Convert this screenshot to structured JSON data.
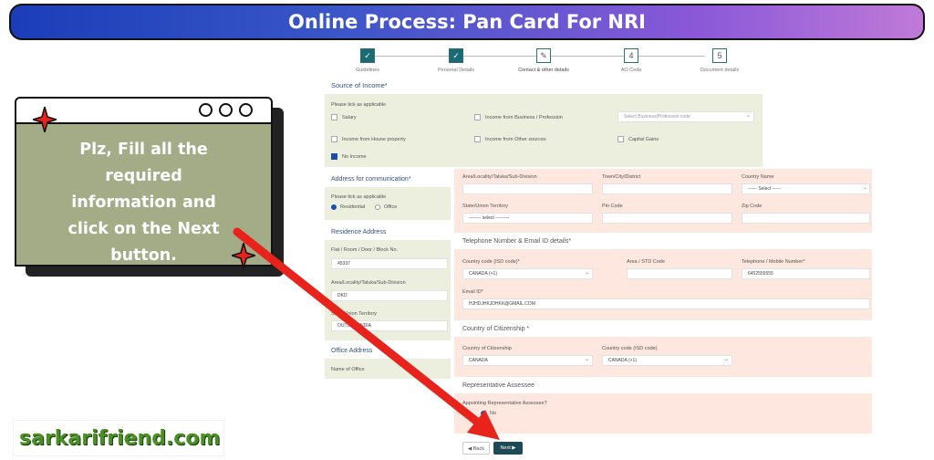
{
  "banner": {
    "title": "Online Process: Pan Card For NRI"
  },
  "stepper": {
    "steps": [
      {
        "label": "Guidelines",
        "mark": "✓"
      },
      {
        "label": "Personal Details",
        "mark": "✓"
      },
      {
        "label": "Contact & other details",
        "mark": "✎"
      },
      {
        "label": "AO Code",
        "mark": "4"
      },
      {
        "label": "Document details",
        "mark": "5"
      }
    ]
  },
  "income": {
    "title": "Source of Income*",
    "hint": "Please tick as applicable",
    "salary": "Salary",
    "business": "Income from Business / Profession",
    "business_placeholder": "Select Business/Profession code",
    "house": "Income from House property",
    "other": "Income from Other sources",
    "capital": "Capital Gains",
    "no_income": "No Income"
  },
  "address_comm": {
    "title": "Address for communication*",
    "hint": "Please tick as applicable",
    "residential": "Residential",
    "office": "Office"
  },
  "residence": {
    "title": "Residence Address",
    "flat_label": "Flat / Room / Door / Block No.",
    "flat_value": "45337",
    "area_label": "Area/Locality/Taluka/Sub-Division",
    "area_value": "DKD",
    "state_label": "State/Union Territory",
    "state_value": "OUTSIDE INDIA"
  },
  "office": {
    "title": "Office Address",
    "name_label": "Name of Office"
  },
  "address_right": {
    "area_label": "Area/Locality/Taluka/Sub-Division",
    "town_label": "Town/City/District",
    "country_label": "Country Name",
    "country_value": "------ Select ------",
    "state_label": "State/Union Territory",
    "state_value": "-------- select ---------",
    "pin_label": "Pin Code",
    "zip_label": "Zip Code"
  },
  "telephone": {
    "title": "Telephone Number & Email ID details*",
    "country_code_label": "Country code (ISD code)*",
    "country_code_value": "CANADA (+1)",
    "std_label": "Area / STD Code",
    "mobile_label": "Telephone / Mobile Number*",
    "mobile_value": "6452555555",
    "email_label": "Email ID*",
    "email_value": "HJHDJHKJDHKK@GMAIL.COM"
  },
  "citizenship": {
    "title": "Country of Citizenship *",
    "country_label": "Country of Citizenship",
    "country_value": "CANADA",
    "code_label": "Country code (ISD code)",
    "code_value": "CANADA (+1)"
  },
  "representative": {
    "title": "Representative Assessee",
    "question": "Appointing Representative Assessee?",
    "no": "No"
  },
  "buttons": {
    "back": "◀ Back",
    "next": "Next ▶"
  },
  "callout": {
    "text": "Plz, Fill all the required information and click on the Next button."
  },
  "logo": {
    "text": "sarkarifriend.com"
  },
  "colors": {
    "arrow": "#e8231b",
    "banner_start": "#1b3db8",
    "banner_end": "#c07ad8",
    "callout_bg": "#a3ab87",
    "next_button": "#1c4a57"
  }
}
